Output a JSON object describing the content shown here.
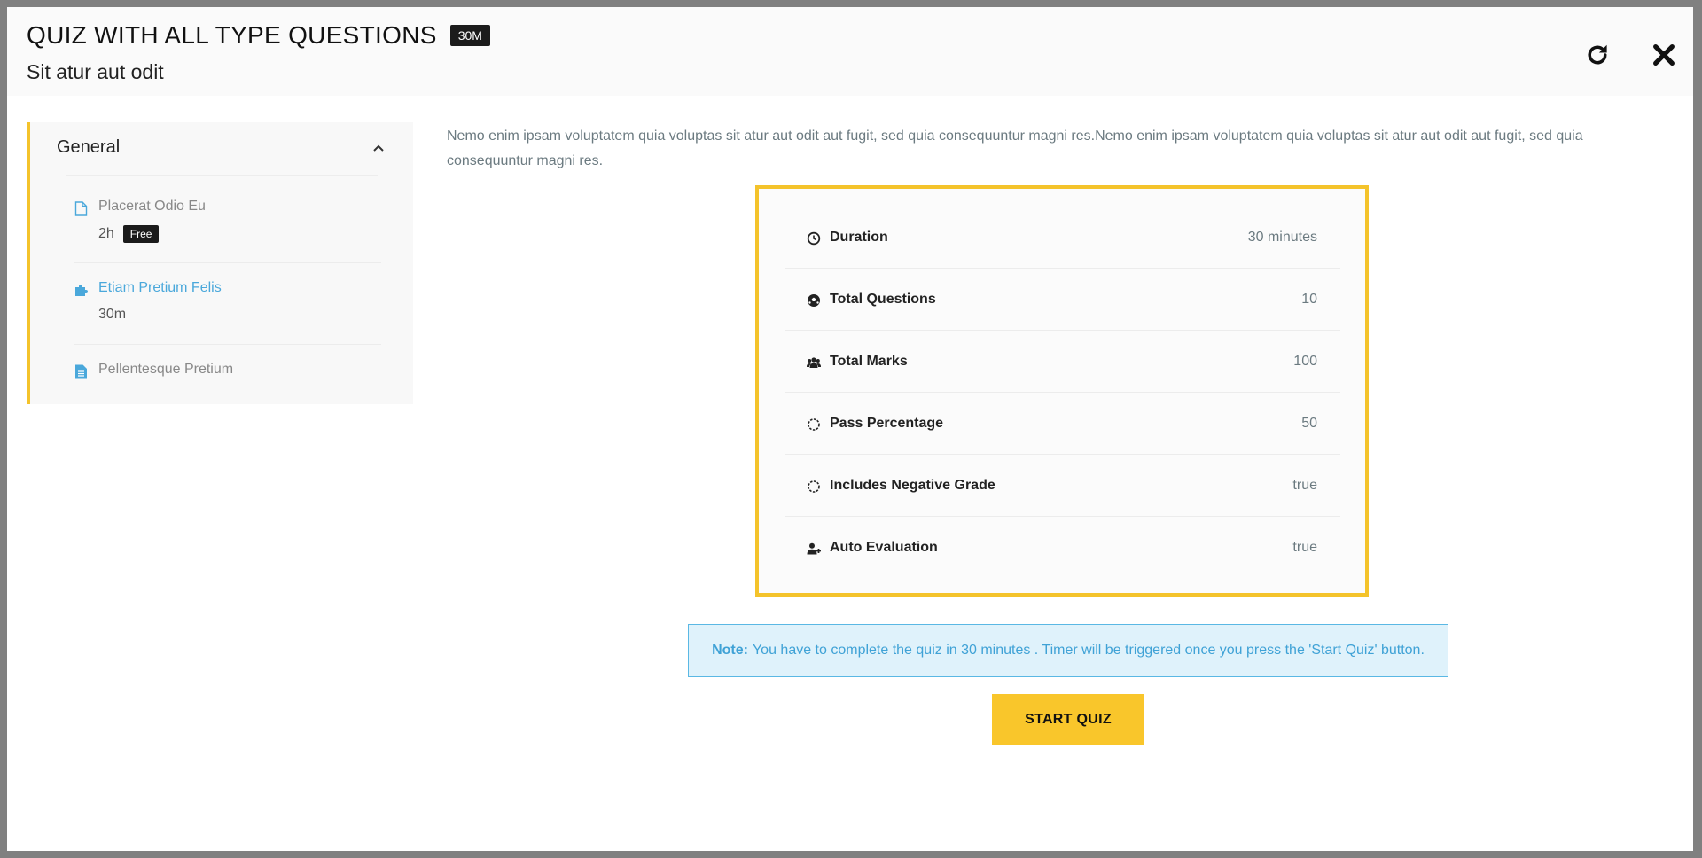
{
  "header": {
    "title": "QUIZ WITH ALL TYPE QUESTIONS",
    "duration_badge": "30M",
    "subtitle": "Sit atur aut odit",
    "reload_icon": "reload-icon",
    "close_icon": "close-icon"
  },
  "sidebar": {
    "section_title": "General",
    "lessons": [
      {
        "name": "Placerat Odio Eu",
        "duration": "2h",
        "badge": "Free",
        "icon": "file-outline-icon",
        "active": false
      },
      {
        "name": "Etiam Pretium Felis",
        "duration": "30m",
        "icon": "puzzle-icon",
        "active": true
      },
      {
        "name": "Pellentesque Pretium",
        "icon": "file-text-icon",
        "active": false
      }
    ]
  },
  "main": {
    "description": "Nemo enim ipsam voluptatem quia voluptas sit atur aut odit aut fugit, sed quia consequuntur magni res.Nemo enim ipsam voluptatem quia voluptas sit atur aut odit aut fugit, sed quia consequuntur magni res.",
    "info": [
      {
        "label": "Duration",
        "value": "30 minutes",
        "icon": "clock-icon"
      },
      {
        "label": "Total Questions",
        "value": "10",
        "icon": "soccer-ball-icon"
      },
      {
        "label": "Total Marks",
        "value": "100",
        "icon": "users-icon"
      },
      {
        "label": "Pass Percentage",
        "value": "50",
        "icon": "spinner-icon"
      },
      {
        "label": "Includes Negative Grade",
        "value": "true",
        "icon": "spinner-icon"
      },
      {
        "label": "Auto Evaluation",
        "value": "true",
        "icon": "user-plus-icon"
      }
    ],
    "note_label": "Note:",
    "note_text": "You have to complete the quiz in 30 minutes . Timer will be triggered once you press the 'Start Quiz' button.",
    "start_button": "START QUIZ"
  },
  "colors": {
    "accent": "#f4c32b",
    "note_bg": "#dff2fb",
    "note_text": "#3fa2d6",
    "active_link": "#4aa8db"
  }
}
